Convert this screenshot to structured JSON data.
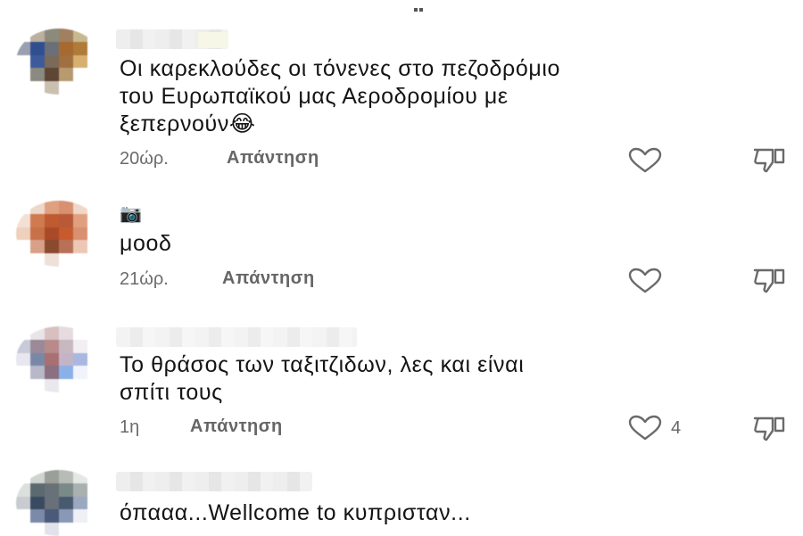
{
  "comments": [
    {
      "text_lines": [
        "Οι καρεκλούδες οι τόνενες στο πεζοδρόμιο",
        "του Ευρωπαϊκού μας Αεροδρομίου με",
        "ξεπερνούν😂"
      ],
      "time": "20ώρ.",
      "reply_label": "Απάντηση",
      "likes": ""
    },
    {
      "name_icon": "📷",
      "text_lines": [
        "μοοδ"
      ],
      "time": "21ώρ.",
      "reply_label": "Απάντηση",
      "likes": ""
    },
    {
      "text_lines": [
        "Το θράσος των ταξιτζιδων, λες και είναι",
        "σπίτι τους"
      ],
      "time": "1η",
      "reply_label": "Απάντηση",
      "likes": "4"
    },
    {
      "text_lines": [
        "όπααα...Wellcome to κυπρισταν..."
      ]
    }
  ],
  "icons": {
    "like": "heart-outline-icon",
    "dislike": "thumbs-down-icon"
  },
  "colors": {
    "text": "#141414",
    "meta": "#6b6b6b",
    "reply": "#666666"
  }
}
